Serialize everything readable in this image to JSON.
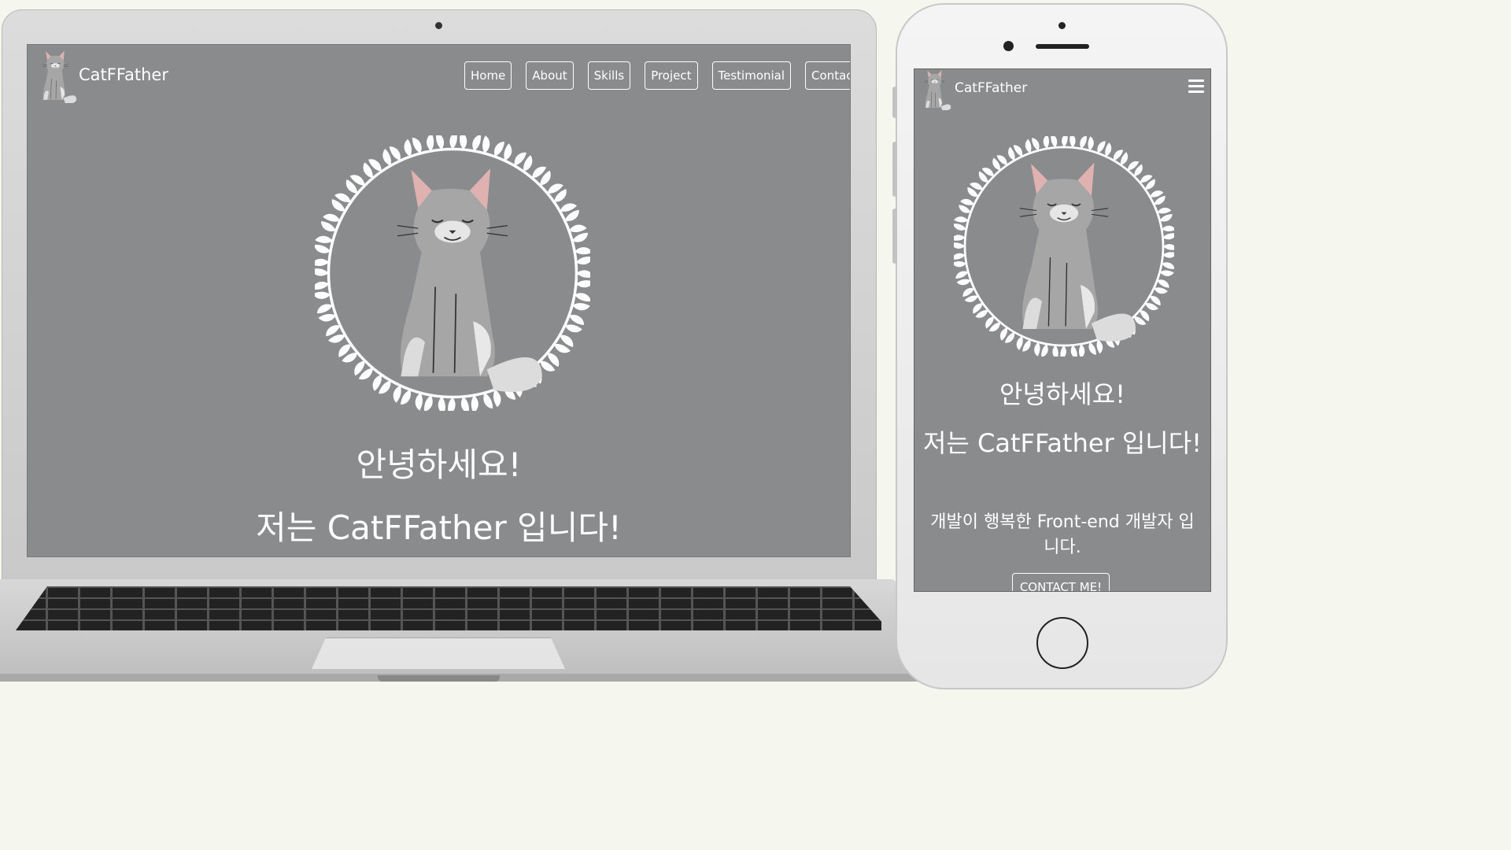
{
  "site": {
    "brand": "CatFFather",
    "nav": [
      "Home",
      "About",
      "Skills",
      "Project",
      "Testimonial",
      "Contac"
    ],
    "greeting": "안녕하세요!",
    "intro": "저는 CatFFather 입니다!",
    "description": "개발이 행복한 Front-end 개발자 입니다.",
    "contact_button": "CONTACT ME!"
  },
  "colors": {
    "screen_bg": "#8a8b8d",
    "text": "#ffffff"
  },
  "icons": {
    "menu": "hamburger-menu-icon",
    "logo": "cat-logo-icon",
    "hero": "cat-wreath-illustration"
  }
}
